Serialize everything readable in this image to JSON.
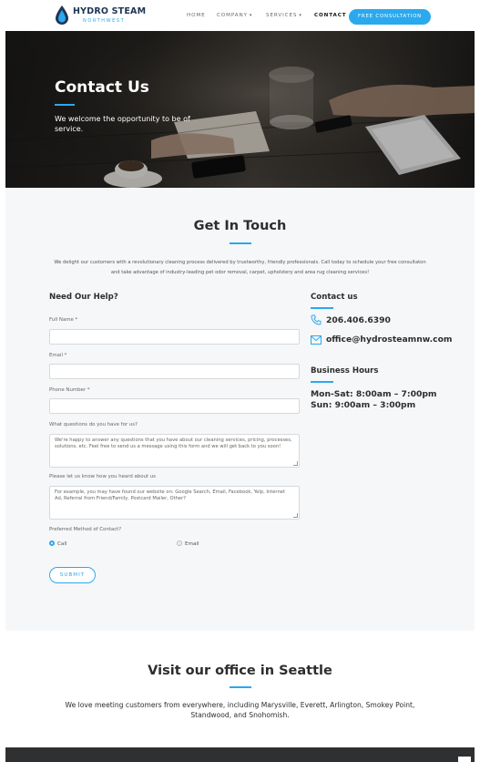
{
  "brand": {
    "name": "HYDRO STEAM",
    "sub": "NORTHWEST",
    "color": "#2aa9ee"
  },
  "nav": {
    "home": "HOME",
    "company": "COMPANY",
    "services": "SERVICES",
    "contact": "CONTACT",
    "cta": "FREE CONSULTATION"
  },
  "hero": {
    "title": "Contact Us",
    "subtitle": "We welcome the opportunity to be of service."
  },
  "get_in_touch": {
    "title": "Get In Touch",
    "intro": "We delight our customers with a revolutionary cleaning process delivered by trustworthy, friendly professionals. Call today to schedule your free consultaton and take advantage of industry-leading pet odor removal, carpet, upholstery and area rug cleaning services!"
  },
  "form": {
    "title": "Need Our Help?",
    "full_name_label": "Full Name *",
    "email_label": "Email *",
    "phone_label": "Phone Number *",
    "questions_label": "What questions do you have for us?",
    "questions_placeholder": "We're happy to answer any questions that you have about our cleaning services, pricing, processes, solutions, etc. Feel free to send us a message using this form and we will get back to you soon!",
    "heard_label": "Please let us know how you heard about us",
    "heard_placeholder": "For example, you may have found our website on: Google Search, Email, Facebook, Yelp, Internet Ad, Referral from Friend/Family, Postcard Mailer, Other?",
    "method_label": "Preferred Method of Contact?",
    "option_call": "Call",
    "option_email": "Email",
    "selected": "Call",
    "submit": "SUBMIT"
  },
  "contact": {
    "title": "Contact us",
    "phone": "206.406.6390",
    "email": "office@hydrosteamnw.com",
    "phone_icon": "phone-icon",
    "email_icon": "envelope-icon"
  },
  "hours": {
    "title": "Business Hours",
    "weekday": "Mon-Sat: 8:00am – 7:00pm",
    "sunday": "Sun: 9:00am – 3:00pm"
  },
  "visit": {
    "title": "Visit our office in Seattle",
    "text": "We love meeting customers from everywhere, including Marysville, Everett, Arlington, Smokey Point, Standwood, and Snohomish."
  }
}
